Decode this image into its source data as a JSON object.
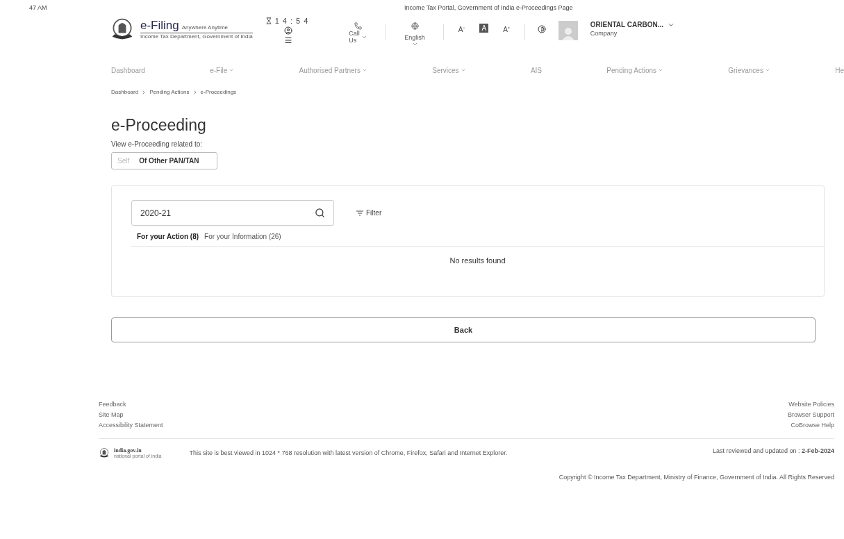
{
  "print_header": {
    "time": "47 AM",
    "title": "Income Tax Portal, Government of India e-Proceedings Page"
  },
  "header": {
    "logo_title": "e-Filing",
    "logo_tagline": "Anywhere Anytime",
    "logo_subtitle": "Income Tax Department, Government of India",
    "timer": "14:54",
    "call": "Call Us",
    "language": "English",
    "user_name": "ORIENTAL CARBON...",
    "user_role": "Company",
    "font_controls": [
      "A⁻",
      "A",
      "A⁺"
    ]
  },
  "nav": [
    {
      "label": "Dashboard",
      "dropdown": false
    },
    {
      "label": "e-File",
      "dropdown": true
    },
    {
      "label": "Authorised Partners",
      "dropdown": true
    },
    {
      "label": "Services",
      "dropdown": true
    },
    {
      "label": "AIS",
      "dropdown": false
    },
    {
      "label": "Pending Actions",
      "dropdown": true
    },
    {
      "label": "Grievances",
      "dropdown": true
    },
    {
      "label": "He",
      "dropdown": false
    }
  ],
  "breadcrumb": [
    "Dashboard",
    "Pending Actions",
    "e-Proceedings"
  ],
  "page_title": "e-Proceeding",
  "related_label": "View e-Proceeding related to:",
  "related_options": [
    {
      "label": "Self",
      "selected": false
    },
    {
      "label": "Of Other PAN/TAN",
      "selected": true
    }
  ],
  "search": {
    "value": "2020-21"
  },
  "filter": "Filter",
  "tabs": [
    {
      "label": "For your Action (8)",
      "selected": true
    },
    {
      "label": "For your Information (26)",
      "selected": false
    }
  ],
  "empty_message": "No results found",
  "back_button": "Back",
  "footer": {
    "links_left": [
      "Feedback",
      "Site Map",
      "Accessibility Statement"
    ],
    "links_right": [
      "Website Policies",
      "Browser Support",
      "CoBrowse Help"
    ],
    "portal": "india.gov.in",
    "portal_tagline": "national portal of india",
    "best_viewed": "This site is best viewed in 1024 * 768 resolution with latest version of Chrome, Firefox, Safari and Internet Explorer.",
    "last_reviewed": "Last reviewed and updated on : **2-Feb-2024**",
    "copyright": "Copyright © Income Tax Department, Ministry of Finance, Government of India. All Rights Reserved"
  }
}
